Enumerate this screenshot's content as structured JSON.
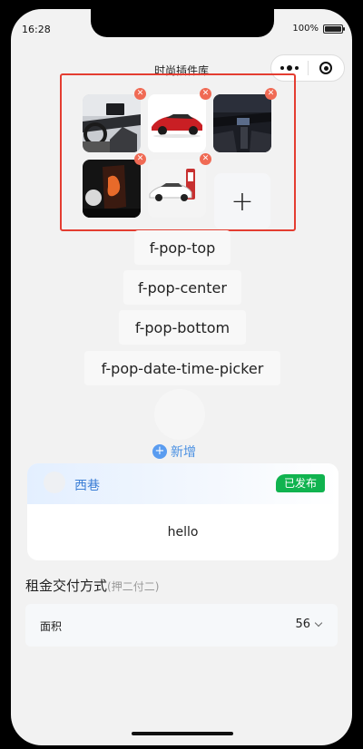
{
  "status": {
    "time": "16:28",
    "battery": "100%"
  },
  "nav": {
    "title": "时尚插件库"
  },
  "uploader": {
    "images": [
      {
        "icon": "car-interior-photo"
      },
      {
        "icon": "red-car-photo"
      },
      {
        "icon": "dark-interior-photo"
      },
      {
        "icon": "dark-screen-photo"
      },
      {
        "icon": "white-car-charging-photo"
      }
    ],
    "add_label": "+"
  },
  "buttons": {
    "pop_top": "f-pop-top",
    "pop_center": "f-pop-center",
    "pop_bottom": "f-pop-bottom",
    "pop_date_time": "f-pop-date-time-picker"
  },
  "add_link": {
    "label": "新增"
  },
  "card": {
    "name": "西巷",
    "badge": "已发布",
    "content": "hello"
  },
  "section": {
    "title": "租金交付方式",
    "subtitle": "(押二付二)"
  },
  "field": {
    "label": "面积",
    "value": "56"
  },
  "colors": {
    "highlight_border": "#e43d31",
    "delete_badge": "#f06a54",
    "accent_blue": "#4a90e2",
    "badge_green": "#10b34f"
  }
}
